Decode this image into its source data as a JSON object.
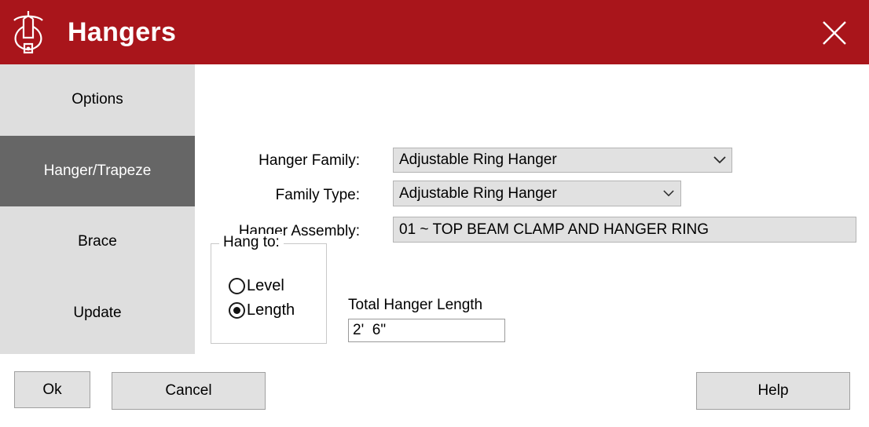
{
  "window": {
    "title": "Hangers",
    "logo_icon": "hanger-logo-icon",
    "close_icon": "close-icon",
    "accent_color": "#a9151b",
    "selected_tab_color": "#666666",
    "sidebar_color": "#dedede",
    "field_color": "#e1e1e1"
  },
  "sidebar": {
    "items": [
      {
        "label": "Options",
        "selected": false
      },
      {
        "label": "Hanger/Trapeze",
        "selected": true
      },
      {
        "label": "Brace",
        "selected": false
      },
      {
        "label": "Update",
        "selected": false
      }
    ]
  },
  "form": {
    "hanger_family": {
      "label": "Hanger Family:",
      "value": "Adjustable Ring Hanger",
      "chevron_icon": "chevron-down-icon"
    },
    "family_type": {
      "label": "Family Type:",
      "value": "Adjustable Ring Hanger",
      "chevron_icon": "chevron-down-icon"
    },
    "hanger_assembly": {
      "label": "Hanger Assembly:",
      "value": "01  ~ TOP BEAM CLAMP AND HANGER RING"
    },
    "hang_to": {
      "legend": "Hang to:",
      "options": [
        {
          "label": "Level",
          "checked": false
        },
        {
          "label": "Length",
          "checked": true
        }
      ]
    },
    "total_hanger_length": {
      "label": "Total Hanger Length",
      "value": "2'  6\"",
      "placeholder": ""
    }
  },
  "footer": {
    "ok_label": "Ok",
    "cancel_label": "Cancel",
    "help_label": "Help"
  }
}
